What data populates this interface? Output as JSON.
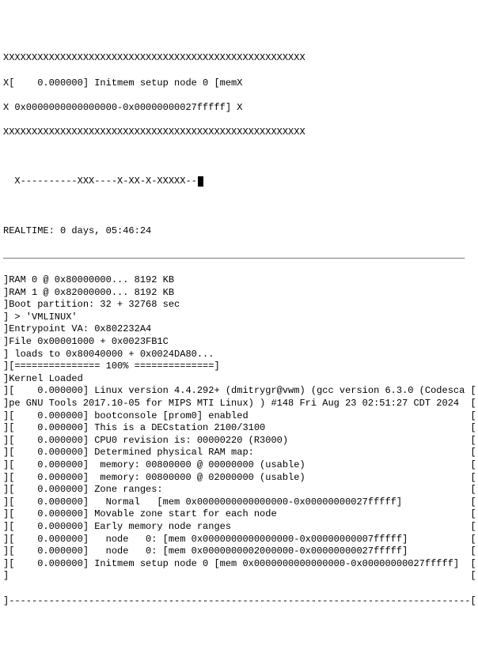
{
  "header": {
    "line1": "XXXXXXXXXXXXXXXXXXXXXXXXXXXXXXXXXXXXXXXXXXXXXXXXXXXXX",
    "line2": "X[    0.000000] Initmem setup node 0 [memX",
    "line3": "X 0x0000000000000000-0x00000000027fffff] X",
    "line4": "XXXXXXXXXXXXXXXXXXXXXXXXXXXXXXXXXXXXXXXXXXXXXXXXXXXXX",
    "progress": "  X----------XXX----X-XX-X-XXXXX--"
  },
  "realtime": "REALTIME: 0 days, 05:46:24",
  "hrule_top": "_________________________________________________________________________________",
  "log_lines": [
    "]RAM 0 @ 0x80000000... 8192 KB",
    "]RAM 1 @ 0x82000000... 8192 KB",
    "]Boot partition: 32 + 32768 sec",
    "] > 'VMLINUX'",
    "]Entrypoint VA: 0x802232A4",
    "]File 0x00001000 + 0x0023FB1C",
    "] loads to 0x80040000 + 0x0024DA80...",
    "][=============== 100% ==============]",
    "]Kernel Loaded",
    "][    0.000000] Linux version 4.4.292+ (dmitrygr@vwm) (gcc version 6.3.0 (Codesca [",
    "]pe GNU Tools 2017.10-05 for MIPS MTI Linux) ) #148 Fri Aug 23 02:51:27 CDT 2024  [",
    "][    0.000000] bootconsole [prom0] enabled                                       [",
    "][    0.000000] This is a DECstation 2100/3100                                    [",
    "][    0.000000] CPU0 revision is: 00000220 (R3000)                                [",
    "][    0.000000] Determined physical RAM map:                                      [",
    "][    0.000000]  memory: 00800000 @ 00000000 (usable)                             [",
    "][    0.000000]  memory: 00800000 @ 02000000 (usable)                             [",
    "][    0.000000] Zone ranges:                                                      [",
    "][    0.000000]   Normal   [mem 0x0000000000000000-0x00000000027fffff]            [",
    "][    0.000000] Movable zone start for each node                                  [",
    "][    0.000000] Early memory node ranges                                          [",
    "][    0.000000]   node   0: [mem 0x0000000000000000-0x00000000007fffff]           [",
    "][    0.000000]   node   0: [mem 0x0000000002000000-0x00000000027fffff]           [",
    "][    0.000000] Initmem setup node 0 [mem 0x0000000000000000-0x00000000027fffff]  [",
    "]                                                                                 ["
  ],
  "hrule_bottom": "]---------------------------------------------------------------------------------["
}
